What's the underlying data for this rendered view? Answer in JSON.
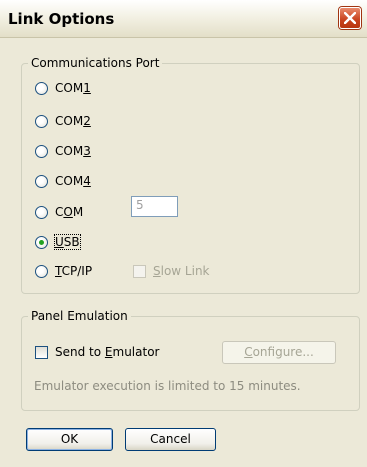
{
  "window": {
    "title": "Link Options"
  },
  "ports": {
    "group_label": "Communications Port",
    "options": [
      {
        "pre": "COM",
        "accel": "1",
        "post": "",
        "selected": false
      },
      {
        "pre": "COM",
        "accel": "2",
        "post": "",
        "selected": false
      },
      {
        "pre": "COM",
        "accel": "3",
        "post": "",
        "selected": false
      },
      {
        "pre": "COM",
        "accel": "4",
        "post": "",
        "selected": false
      },
      {
        "pre": "C",
        "accel": "O",
        "post": "M",
        "selected": false
      },
      {
        "pre": "",
        "accel": "U",
        "post": "SB",
        "selected": true
      },
      {
        "pre": "",
        "accel": "T",
        "post": "CP/IP",
        "selected": false
      }
    ],
    "com_number": "5",
    "slow_link": {
      "pre": "",
      "accel": "S",
      "post": "low Link",
      "checked": false,
      "enabled": false
    }
  },
  "emulation": {
    "group_label": "Panel Emulation",
    "send": {
      "pre": "Send to ",
      "accel": "E",
      "post": "mulator",
      "checked": false
    },
    "configure": {
      "pre": "",
      "accel": "C",
      "post": "onfigure..."
    },
    "note": "Emulator execution is limited to 15 minutes."
  },
  "buttons": {
    "ok": "OK",
    "cancel": "Cancel"
  }
}
